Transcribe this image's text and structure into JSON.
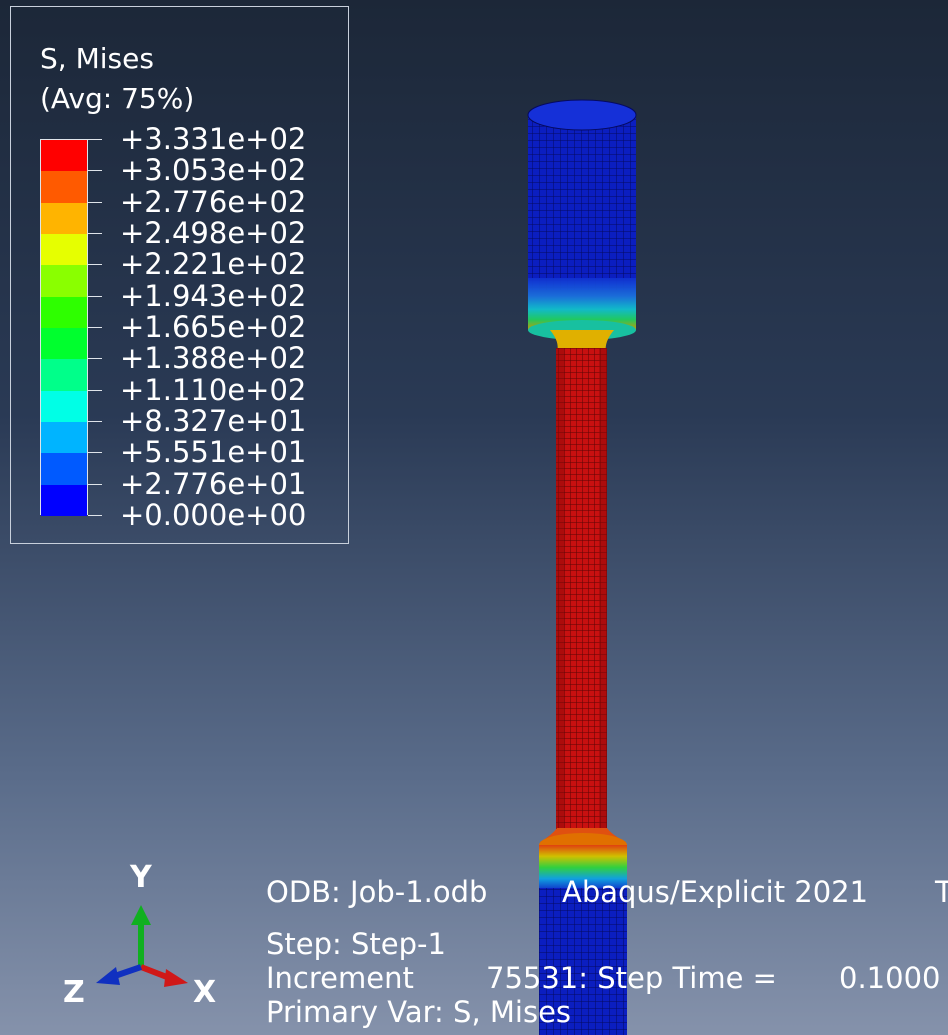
{
  "legend": {
    "title": "S, Mises",
    "subtitle": "(Avg: 75%)",
    "bands": [
      "#ff0000",
      "#ff5a00",
      "#ffb400",
      "#e6ff00",
      "#8aff00",
      "#2eff00",
      "#00ff2e",
      "#00ff8a",
      "#00ffe6",
      "#00b4ff",
      "#005aff",
      "#0000ff"
    ],
    "ticks": [
      "+3.331e+02",
      "+3.053e+02",
      "+2.776e+02",
      "+2.498e+02",
      "+2.221e+02",
      "+1.943e+02",
      "+1.665e+02",
      "+1.388e+02",
      "+1.110e+02",
      "+8.327e+01",
      "+5.551e+01",
      "+2.776e+01",
      "+0.000e+00"
    ]
  },
  "triad": {
    "y_label": "Y",
    "z_label": "Z",
    "x_label": "X",
    "colors": {
      "y": "#10b020",
      "x": "#d01818",
      "z": "#1030c0"
    }
  },
  "info": {
    "odb": "ODB: Job-1.odb",
    "solver": "Abaqus/Explicit 2021",
    "trailing": "T",
    "step": "Step: Step-1",
    "increment_label": "Increment",
    "increment_value": "75531: Step Time =",
    "step_time": "0.1000",
    "primary_var": "Primary Var: S, Mises"
  },
  "colors": {
    "background_top": "#1c2738",
    "background_bottom": "#8592ab",
    "specimen_grip": "#0a1fb8",
    "specimen_gauge": "#c41010"
  }
}
